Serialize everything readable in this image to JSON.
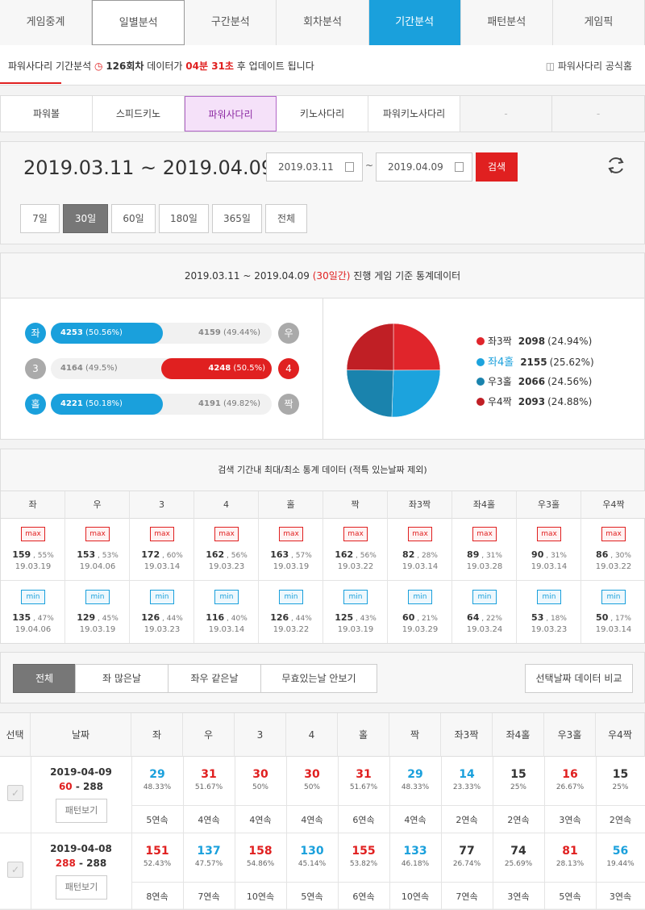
{
  "top_tabs": [
    "게임중계",
    "일별분석",
    "구간분석",
    "회차분석",
    "기간분석",
    "패턴분석",
    "게임픽"
  ],
  "notice": {
    "prefix": "파워사다리 기간분석",
    "round": "126회차",
    "mid": "데이터가",
    "time": "04분 31초",
    "suffix": "후 업데이트 됩니다",
    "official": "파워사다리 공식홈"
  },
  "sub_tabs": [
    "파워볼",
    "스피드키노",
    "파워사다리",
    "키노사다리",
    "파워키노사다리",
    "-",
    "-"
  ],
  "date_range": {
    "title": "2019.03.11 ~ 2019.04.09",
    "start": "2019.03.11",
    "tilde": "~",
    "end": "2019.04.09",
    "search": "검색"
  },
  "periods": [
    "7일",
    "30일",
    "60일",
    "180일",
    "365일",
    "전체"
  ],
  "stats": {
    "head_range": "2019.03.11 ~ 2019.04.09",
    "head_days": "(30일간)",
    "head_suffix": "진행 게임 기준 통계데이터",
    "bars": [
      {
        "left_label": "좌",
        "left_val": "4253",
        "left_pct": "(50.56%)",
        "right_val": "4159",
        "right_pct": "(49.44%)",
        "right_label": "우",
        "fill_side": "left",
        "fraction": 0.5056
      },
      {
        "left_label": "3",
        "left_val": "4164",
        "left_pct": "(49.5%)",
        "right_val": "4248",
        "right_pct": "(50.5%)",
        "right_label": "4",
        "fill_side": "right",
        "fraction": 0.505
      },
      {
        "left_label": "홀",
        "left_val": "4221",
        "left_pct": "(50.18%)",
        "right_val": "4191",
        "right_pct": "(49.82%)",
        "right_label": "짝",
        "fill_side": "left",
        "fraction": 0.5018
      }
    ],
    "pie": [
      {
        "label": "좌3짝",
        "value": "2098",
        "pct": "(24.94%)",
        "fraction": 0.2494,
        "color": "#e0252b"
      },
      {
        "label": "좌4홀",
        "value": "2155",
        "pct": "(25.62%)",
        "fraction": 0.2562,
        "color": "#1ca3dd"
      },
      {
        "label": "우3홀",
        "value": "2066",
        "pct": "(24.56%)",
        "fraction": 0.2456,
        "color": "#1a83ad"
      },
      {
        "label": "우4짝",
        "value": "2093",
        "pct": "(24.88%)",
        "fraction": 0.2488,
        "color": "#c01f25"
      }
    ]
  },
  "minmax": {
    "head": "검색 기간내 최대/최소 통계 데이터 (적특 있는날짜 제외)",
    "max_label": "max",
    "min_label": "min",
    "cols": [
      {
        "h": "좌",
        "max": "159",
        "maxp": "55%",
        "maxd": "19.03.19",
        "min": "135",
        "minp": "47%",
        "mind": "19.04.06"
      },
      {
        "h": "우",
        "max": "153",
        "maxp": "53%",
        "maxd": "19.04.06",
        "min": "129",
        "minp": "45%",
        "mind": "19.03.19"
      },
      {
        "h": "3",
        "max": "172",
        "maxp": "60%",
        "maxd": "19.03.14",
        "min": "126",
        "minp": "44%",
        "mind": "19.03.23"
      },
      {
        "h": "4",
        "max": "162",
        "maxp": "56%",
        "maxd": "19.03.23",
        "min": "116",
        "minp": "40%",
        "mind": "19.03.14"
      },
      {
        "h": "홀",
        "max": "163",
        "maxp": "57%",
        "maxd": "19.03.19",
        "min": "126",
        "minp": "44%",
        "mind": "19.03.22"
      },
      {
        "h": "짝",
        "max": "162",
        "maxp": "56%",
        "maxd": "19.03.22",
        "min": "125",
        "minp": "43%",
        "mind": "19.03.19"
      },
      {
        "h": "좌3짝",
        "max": "82",
        "maxp": "28%",
        "maxd": "19.03.14",
        "min": "60",
        "minp": "21%",
        "mind": "19.03.29"
      },
      {
        "h": "좌4홀",
        "max": "89",
        "maxp": "31%",
        "maxd": "19.03.28",
        "min": "64",
        "minp": "22%",
        "mind": "19.03.24"
      },
      {
        "h": "우3홀",
        "max": "90",
        "maxp": "31%",
        "maxd": "19.03.14",
        "min": "53",
        "minp": "18%",
        "mind": "19.03.23"
      },
      {
        "h": "우4짝",
        "max": "86",
        "maxp": "30%",
        "maxd": "19.03.22",
        "min": "50",
        "minp": "17%",
        "mind": "19.03.14"
      }
    ]
  },
  "filters": [
    "전체",
    "좌 많은날",
    "좌우 같은날",
    "무효있는날 안보기"
  ],
  "compare": "선택날짜 데이터 비교",
  "table": {
    "headers": [
      "선택",
      "날짜",
      "좌",
      "우",
      "3",
      "4",
      "홀",
      "짝",
      "좌3짝",
      "좌4홀",
      "우3홀",
      "우4짝"
    ],
    "pattern_btn": "패턴보기",
    "rows": [
      {
        "date": "2019-04-09",
        "range_a": "60",
        "range_sep": "-",
        "range_b": "288",
        "cells": [
          [
            "29",
            "48.33%",
            "5연속",
            "blue"
          ],
          [
            "31",
            "51.67%",
            "4연속",
            "red"
          ],
          [
            "30",
            "50%",
            "4연속",
            "red"
          ],
          [
            "30",
            "50%",
            "4연속",
            "red"
          ],
          [
            "31",
            "51.67%",
            "6연속",
            "red"
          ],
          [
            "29",
            "48.33%",
            "4연속",
            "blue"
          ],
          [
            "14",
            "23.33%",
            "2연속",
            "blue"
          ],
          [
            "15",
            "25%",
            "2연속",
            "dark"
          ],
          [
            "16",
            "26.67%",
            "3연속",
            "red"
          ],
          [
            "15",
            "25%",
            "2연속",
            "dark"
          ]
        ]
      },
      {
        "date": "2019-04-08",
        "range_a": "288",
        "range_sep": "-",
        "range_b": "288",
        "cells": [
          [
            "151",
            "52.43%",
            "8연속",
            "red"
          ],
          [
            "137",
            "47.57%",
            "7연속",
            "blue"
          ],
          [
            "158",
            "54.86%",
            "10연속",
            "red"
          ],
          [
            "130",
            "45.14%",
            "5연속",
            "blue"
          ],
          [
            "155",
            "53.82%",
            "6연속",
            "red"
          ],
          [
            "133",
            "46.18%",
            "10연속",
            "blue"
          ],
          [
            "77",
            "26.74%",
            "7연속",
            "dark"
          ],
          [
            "74",
            "25.69%",
            "3연속",
            "dark"
          ],
          [
            "81",
            "28.13%",
            "5연속",
            "red"
          ],
          [
            "56",
            "19.44%",
            "3연속",
            "blue"
          ]
        ]
      }
    ]
  }
}
